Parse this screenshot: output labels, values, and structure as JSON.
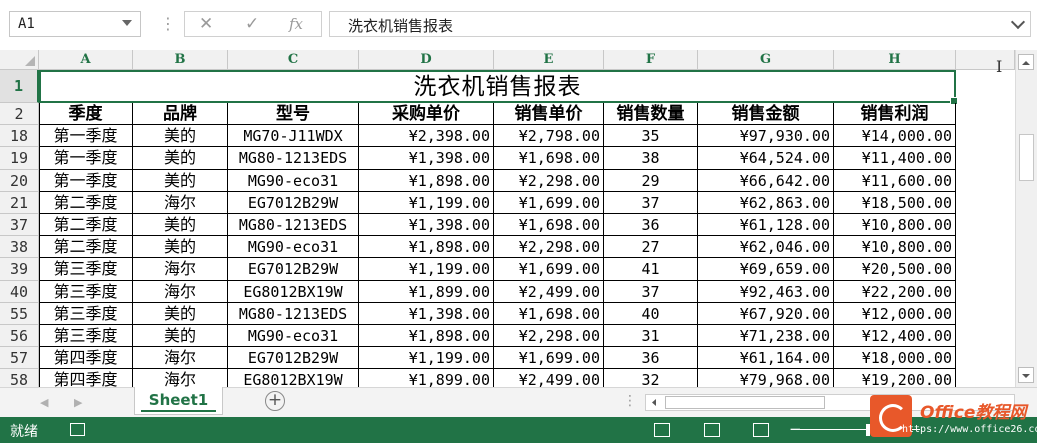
{
  "formula_bar": {
    "name_box": "A1",
    "formula": "洗衣机销售报表",
    "cancel_glyph": "✕",
    "enter_glyph": "✓",
    "fx_glyph": "fx",
    "more_glyph": "⋮"
  },
  "columns": [
    "A",
    "B",
    "C",
    "D",
    "E",
    "F",
    "G",
    "H"
  ],
  "title_row": {
    "row": "1",
    "text": "洗衣机销售报表"
  },
  "header_row": {
    "row": "2",
    "cells": [
      "季度",
      "品牌",
      "型号",
      "采购单价",
      "销售单价",
      "销售数量",
      "销售金额",
      "销售利润"
    ]
  },
  "rows": [
    {
      "row": "18",
      "cells": [
        "第一季度",
        "美的",
        "MG70-J11WDX",
        "¥2,398.00",
        "¥2,798.00",
        "35",
        "¥97,930.00",
        "¥14,000.00"
      ]
    },
    {
      "row": "19",
      "cells": [
        "第一季度",
        "美的",
        "MG80-1213EDS",
        "¥1,398.00",
        "¥1,698.00",
        "38",
        "¥64,524.00",
        "¥11,400.00"
      ]
    },
    {
      "row": "20",
      "cells": [
        "第一季度",
        "美的",
        "MG90-eco31",
        "¥1,898.00",
        "¥2,298.00",
        "29",
        "¥66,642.00",
        "¥11,600.00"
      ]
    },
    {
      "row": "21",
      "cells": [
        "第二季度",
        "海尔",
        "EG7012B29W",
        "¥1,199.00",
        "¥1,699.00",
        "37",
        "¥62,863.00",
        "¥18,500.00"
      ]
    },
    {
      "row": "37",
      "cells": [
        "第二季度",
        "美的",
        "MG80-1213EDS",
        "¥1,398.00",
        "¥1,698.00",
        "36",
        "¥61,128.00",
        "¥10,800.00"
      ]
    },
    {
      "row": "38",
      "cells": [
        "第二季度",
        "美的",
        "MG90-eco31",
        "¥1,898.00",
        "¥2,298.00",
        "27",
        "¥62,046.00",
        "¥10,800.00"
      ]
    },
    {
      "row": "39",
      "cells": [
        "第三季度",
        "海尔",
        "EG7012B29W",
        "¥1,199.00",
        "¥1,699.00",
        "41",
        "¥69,659.00",
        "¥20,500.00"
      ]
    },
    {
      "row": "40",
      "cells": [
        "第三季度",
        "海尔",
        "EG8012BX19W",
        "¥1,899.00",
        "¥2,499.00",
        "37",
        "¥92,463.00",
        "¥22,200.00"
      ]
    },
    {
      "row": "55",
      "cells": [
        "第三季度",
        "美的",
        "MG80-1213EDS",
        "¥1,398.00",
        "¥1,698.00",
        "40",
        "¥67,920.00",
        "¥12,000.00"
      ]
    },
    {
      "row": "56",
      "cells": [
        "第三季度",
        "美的",
        "MG90-eco31",
        "¥1,898.00",
        "¥2,298.00",
        "31",
        "¥71,238.00",
        "¥12,400.00"
      ]
    },
    {
      "row": "57",
      "cells": [
        "第四季度",
        "海尔",
        "EG7012B29W",
        "¥1,199.00",
        "¥1,699.00",
        "36",
        "¥61,164.00",
        "¥18,000.00"
      ]
    },
    {
      "row": "58",
      "cells": [
        "第四季度",
        "海尔",
        "EG8012BX19W",
        "¥1,899.00",
        "¥2,499.00",
        "32",
        "¥79,968.00",
        "¥19,200.00"
      ]
    }
  ],
  "sheet_tabs": {
    "active": "Sheet1",
    "add_glyph": "+"
  },
  "status_bar": {
    "ready": "就绪",
    "zoom_minus": "−"
  },
  "watermark": {
    "name": "Office教程网",
    "url": "https://www.office26.com"
  },
  "colors": {
    "accent": "#217346",
    "watermark": "#e8582a"
  },
  "icons": [
    "chevron-down-icon",
    "cancel-icon",
    "enter-icon",
    "fx-icon",
    "add-sheet-icon",
    "macro-record-icon",
    "normal-view-icon",
    "page-layout-icon",
    "page-break-icon"
  ]
}
